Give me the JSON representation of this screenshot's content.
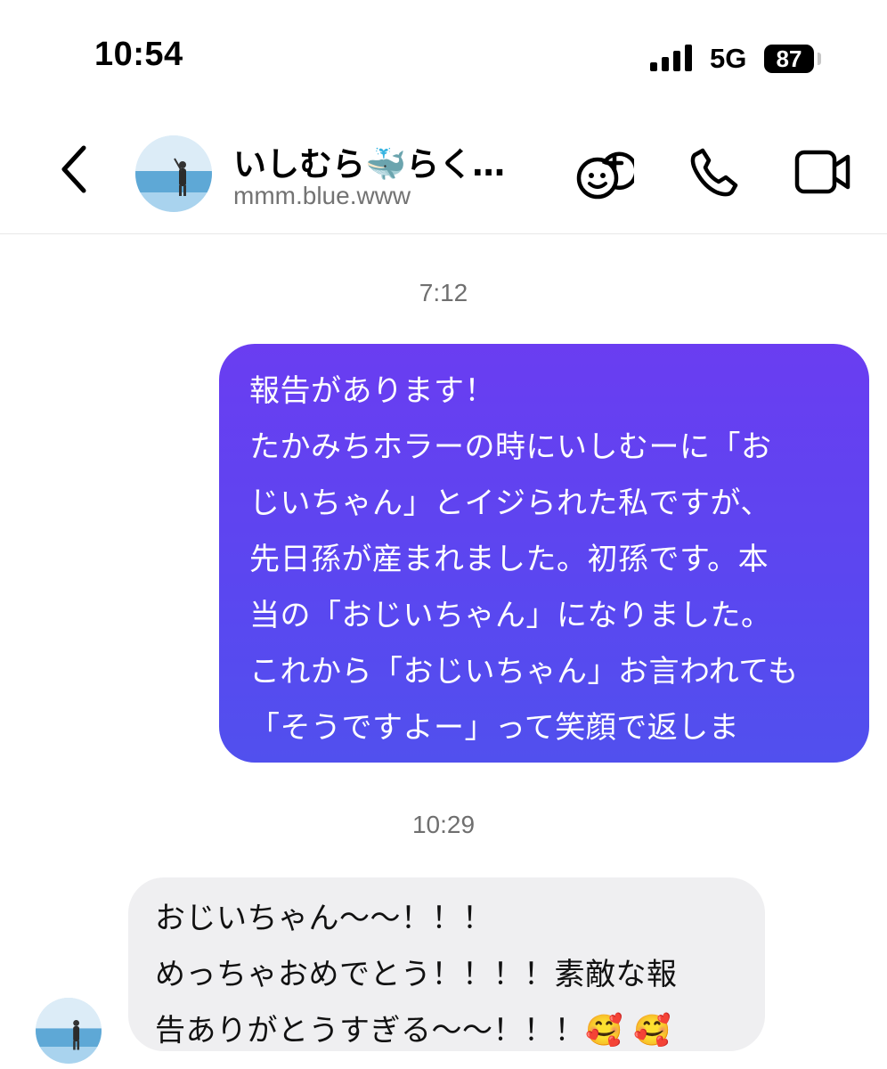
{
  "status_bar": {
    "time": "10:54",
    "network": "5G",
    "battery": "87"
  },
  "header": {
    "name": "いしむら🐳らく…",
    "username": "mmm.blue.www",
    "icons": [
      "chevron-left-icon",
      "sticker-add-icon",
      "phone-icon",
      "video-camera-icon"
    ]
  },
  "thread": {
    "messages": [
      {
        "timestamp": "7:12",
        "direction": "outgoing",
        "text": "報告があります！\nたかみちホラーの時にいしむーに「お\nじいちゃん」とイジられた私ですが、\n先日孫が産まれました。初孫です。本\n当の「おじいちゃん」になりました。\nこれから「おじいちゃん」お言われても\n「そうですよー」って笑顔で返しま\nす！！"
      },
      {
        "timestamp": "10:29",
        "direction": "incoming",
        "text": "おじいちゃん〜〜！！！\nめっちゃおめでとう！！！！素敵な報\n告ありがとうすぎる〜〜！！！🥰 🥰"
      }
    ]
  },
  "colors": {
    "outgoing_bubble_top": "#6a3df1",
    "outgoing_bubble_bottom": "#5150ee",
    "incoming_bubble": "#efeff1",
    "timestamp_text": "#6f6f6f"
  }
}
